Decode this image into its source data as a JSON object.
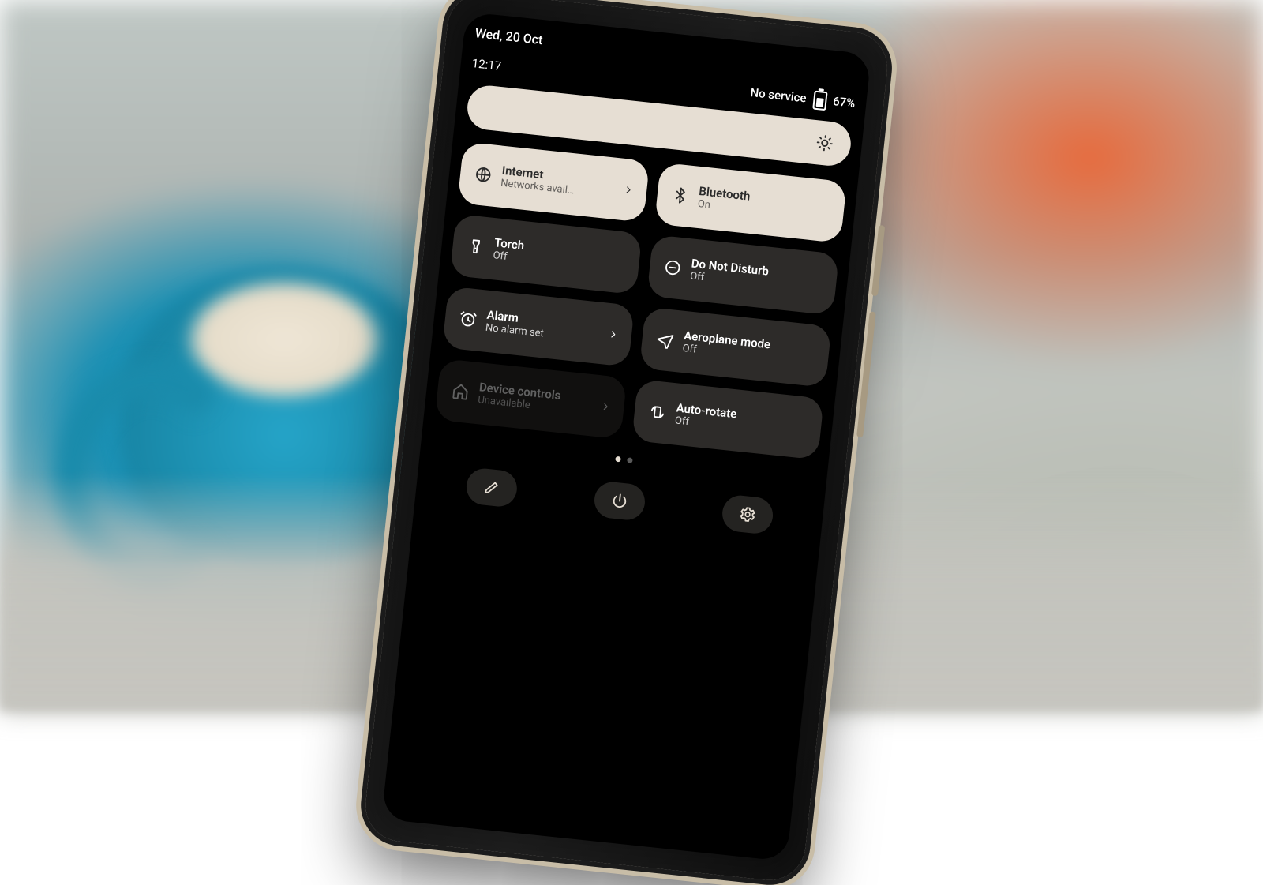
{
  "status": {
    "date": "Wed, 20 Oct",
    "time": "12:17",
    "service": "No service",
    "battery_pct": "67%"
  },
  "tiles": {
    "internet": {
      "title": "Internet",
      "subtitle": "Networks avail…"
    },
    "bluetooth": {
      "title": "Bluetooth",
      "subtitle": "On"
    },
    "torch": {
      "title": "Torch",
      "subtitle": "Off"
    },
    "dnd": {
      "title": "Do Not Disturb",
      "subtitle": "Off"
    },
    "alarm": {
      "title": "Alarm",
      "subtitle": "No alarm set"
    },
    "aeroplane": {
      "title": "Aeroplane mode",
      "subtitle": "Off"
    },
    "device_controls": {
      "title": "Device controls",
      "subtitle": "Unavailable"
    },
    "autorotate": {
      "title": "Auto-rotate",
      "subtitle": "Off"
    }
  }
}
